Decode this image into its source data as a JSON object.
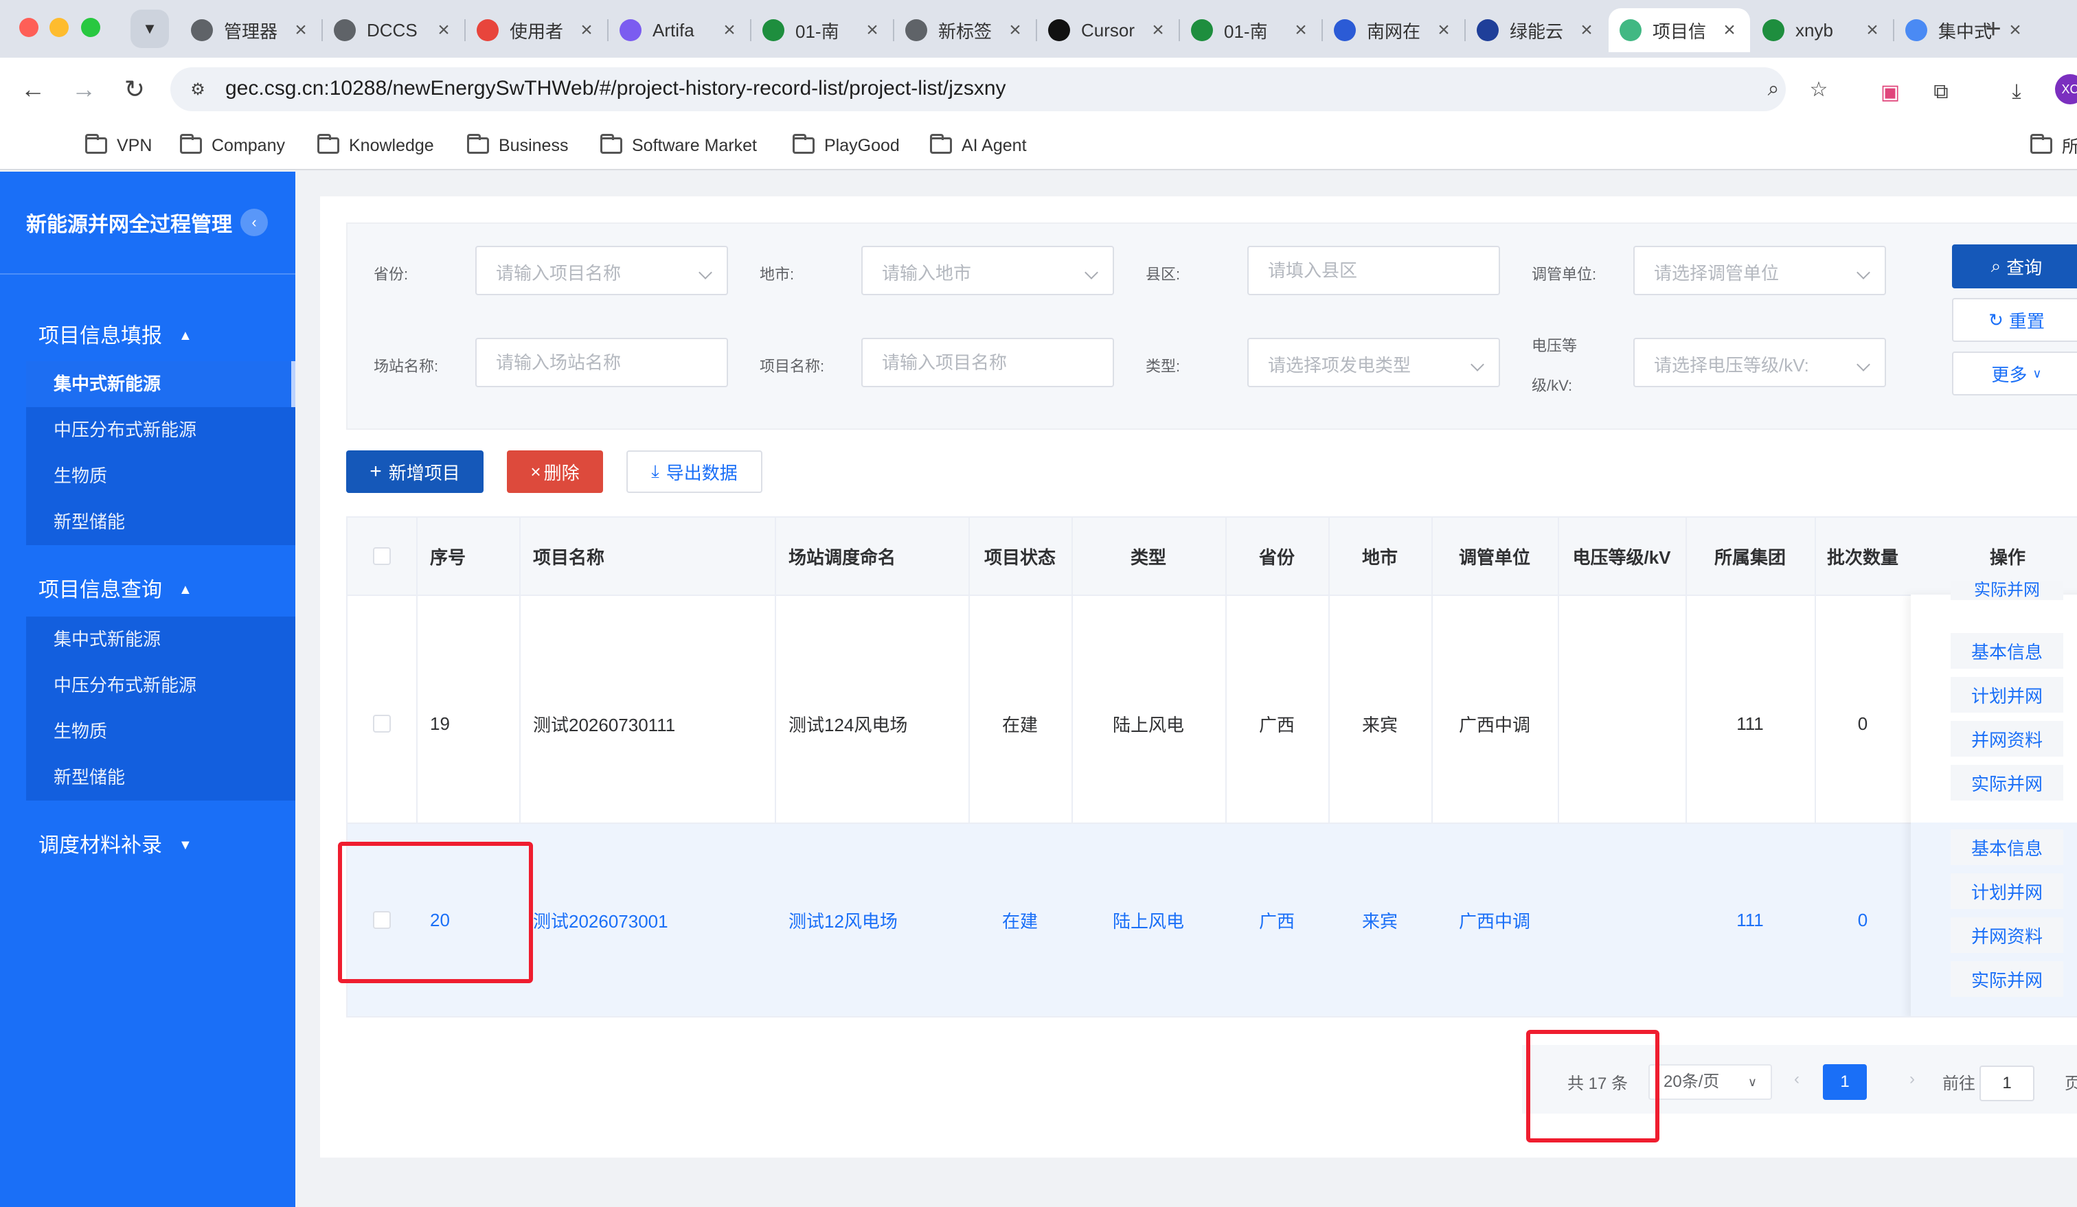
{
  "browser": {
    "tabs": [
      {
        "title": "管理器",
        "favicon": "globe-icon",
        "color": "#5f6368"
      },
      {
        "title": "DCCS",
        "favicon": "globe-icon",
        "color": "#5f6368"
      },
      {
        "title": "使用者",
        "favicon": "chrome-colorful-icon",
        "color": "#e8453c"
      },
      {
        "title": "Artifa",
        "favicon": "c-logo-icon",
        "color": "#7b5cf0"
      },
      {
        "title": "01-南",
        "favicon": "sheet-s-icon",
        "color": "#1e8e3e"
      },
      {
        "title": "新标签",
        "favicon": "globe-icon",
        "color": "#5f6368"
      },
      {
        "title": "Cursor",
        "favicon": "cursor-logo-icon",
        "color": "#111111"
      },
      {
        "title": "01-南",
        "favicon": "sheet-s-icon",
        "color": "#1e8e3e"
      },
      {
        "title": "南网在",
        "favicon": "baidu-paw-icon",
        "color": "#2b5bd6"
      },
      {
        "title": "绿能云",
        "favicon": "stripes-logo-icon",
        "color": "#1f3f99"
      },
      {
        "title": "项目信",
        "favicon": "vue-logo-icon",
        "color": "#41b883"
      },
      {
        "title": "xnyb",
        "favicon": "sheet-s-icon",
        "color": "#1e8e3e"
      },
      {
        "title": "集中式",
        "favicon": "cloud-icon",
        "color": "#4a8af4"
      }
    ],
    "url": "gec.csg.cn:10288/newEnergySwTHWeb/#/project-history-record-list/project-list/jzsxny",
    "profile_initials": "XC",
    "bookmarks": [
      "VPN",
      "Company",
      "Knowledge",
      "Business",
      "Software Market",
      "PlayGood",
      "AI Agent"
    ],
    "all_bookmarks": "所有书签"
  },
  "sidebar": {
    "title": "新能源并网全过程管理",
    "groups": [
      {
        "label": "项目信息填报",
        "arrow": "▲",
        "items": [
          "集中式新能源",
          "中压分布式新能源",
          "生物质",
          "新型储能"
        ]
      },
      {
        "label": "项目信息查询",
        "arrow": "▲",
        "items": [
          "集中式新能源",
          "中压分布式新能源",
          "生物质",
          "新型储能"
        ]
      },
      {
        "label": "调度材料补录",
        "arrow": "▼",
        "items": []
      }
    ]
  },
  "filters": {
    "province": {
      "label": "省份:",
      "placeholder": "请输入项目名称"
    },
    "city": {
      "label": "地市:",
      "placeholder": "请输入地市"
    },
    "county": {
      "label": "县区:",
      "placeholder": "请填入县区"
    },
    "dispatch_unit": {
      "label": "调管单位:",
      "placeholder": "请选择调管单位"
    },
    "station_name": {
      "label": "场站名称:",
      "placeholder": "请输入场站名称"
    },
    "project_name": {
      "label": "项目名称:",
      "placeholder": "请输入项目名称"
    },
    "type": {
      "label": "类型:",
      "placeholder": "请选择项发电类型"
    },
    "voltage": {
      "label_line1": "电压等",
      "label_line2": "级/kV:",
      "placeholder": "请选择电压等级/kV:"
    }
  },
  "actions": {
    "query": "查询",
    "reset": "重置",
    "more": "更多",
    "add": "新增项目",
    "delete": "删除",
    "export": "导出数据"
  },
  "table": {
    "headers": [
      "序号",
      "项目名称",
      "场站调度命名",
      "项目状态",
      "类型",
      "省份",
      "地市",
      "调管单位",
      "电压等级/kV",
      "所属集团",
      "批次数量",
      "操作"
    ],
    "rows": [
      {
        "index": "19",
        "project_name": "测试20260730111",
        "station": "测试124风电场",
        "status": "在建",
        "type": "陆上风电",
        "province": "广西",
        "city": "来宾",
        "unit": "广西中调",
        "voltage": "",
        "group": "111",
        "batch": "0"
      },
      {
        "index": "20",
        "project_name": "测试2026073001",
        "station": "测试12风电场",
        "status": "在建",
        "type": "陆上风电",
        "province": "广西",
        "city": "来宾",
        "unit": "广西中调",
        "voltage": "",
        "group": "111",
        "batch": "0"
      }
    ],
    "ops": [
      "基本信息",
      "计划并网",
      "并网资料",
      "实际并网"
    ],
    "partial_op": "实际并网"
  },
  "pagination": {
    "total": "共 17 条",
    "page_size": "20条/页",
    "current_page": "1",
    "goto_label": "前往",
    "goto_value": "1",
    "page_suffix": "页"
  },
  "colors": {
    "sidebar": "#1a6ff7",
    "primary_button": "#1558b9",
    "danger_button": "#dd4a3c",
    "link": "#1a6ff7",
    "highlight_box": "#ef1d2f"
  }
}
